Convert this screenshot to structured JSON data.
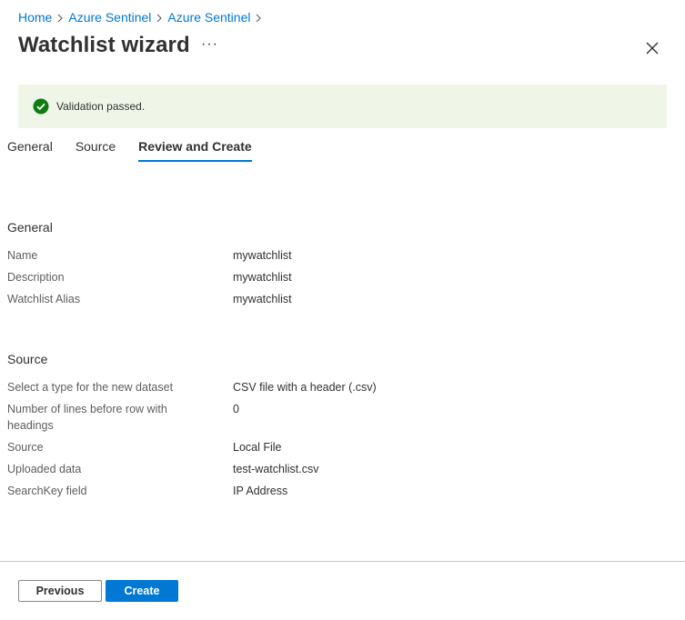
{
  "breadcrumb": [
    "Home",
    "Azure Sentinel",
    "Azure Sentinel"
  ],
  "title": "Watchlist wizard",
  "more_label": "···",
  "banner": {
    "text": "Validation passed."
  },
  "tabs": [
    "General",
    "Source",
    "Review and Create"
  ],
  "general": {
    "title": "General",
    "rows": [
      {
        "label": "Name",
        "value": "mywatchlist"
      },
      {
        "label": "Description",
        "value": "mywatchlist"
      },
      {
        "label": "Watchlist Alias",
        "value": "mywatchlist"
      }
    ]
  },
  "source": {
    "title": "Source",
    "rows": [
      {
        "label": "Select a type for the new dataset",
        "value": "CSV file with a header (.csv)"
      },
      {
        "label": "Number of lines before row with headings",
        "value": "0"
      },
      {
        "label": "Source",
        "value": "Local File"
      },
      {
        "label": "Uploaded data",
        "value": "test-watchlist.csv"
      },
      {
        "label": "SearchKey field",
        "value": "IP Address"
      }
    ]
  },
  "buttons": {
    "previous": "Previous",
    "create": "Create"
  },
  "colors": {
    "accent": "#0078d4",
    "success": "#107c10",
    "banner_bg": "#eff6e8"
  }
}
